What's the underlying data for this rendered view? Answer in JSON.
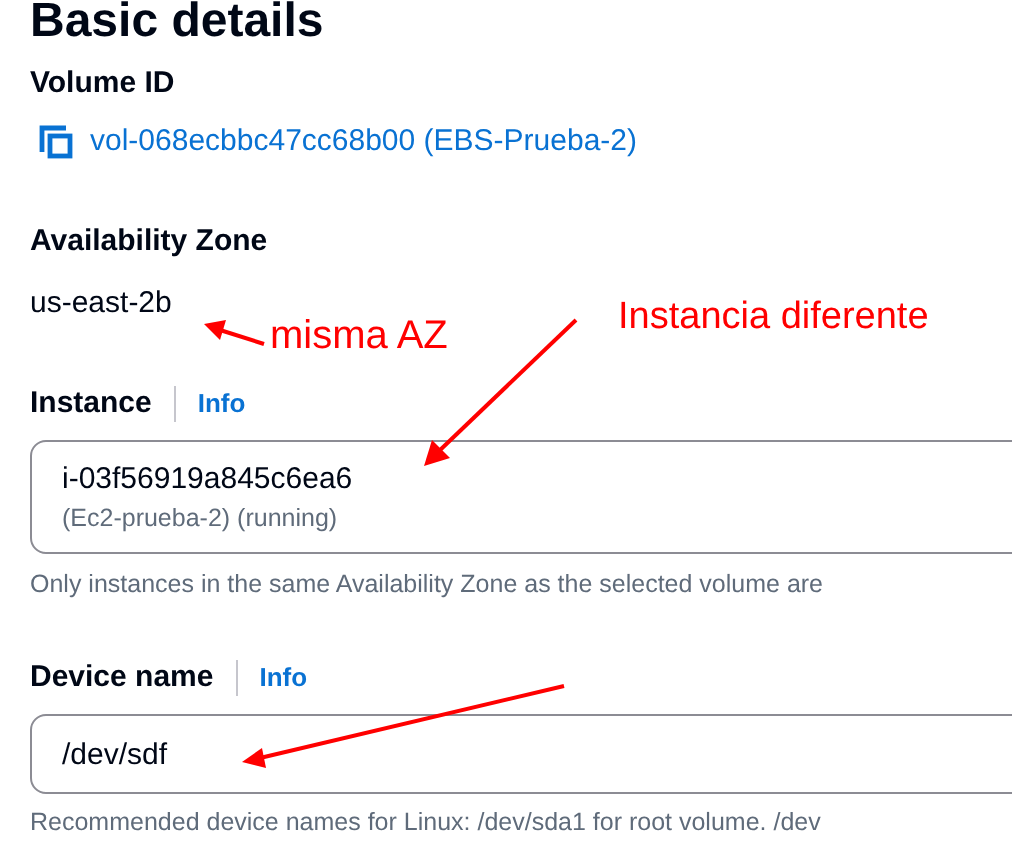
{
  "section": {
    "title": "Basic details"
  },
  "volume": {
    "label": "Volume ID",
    "link": "vol-068ecbbc47cc68b00 (EBS-Prueba-2)"
  },
  "availability_zone": {
    "label": "Availability Zone",
    "value": "us-east-2b"
  },
  "instance": {
    "label": "Instance",
    "info": "Info",
    "value": "i-03f56919a845c6ea6",
    "detail": "(Ec2-prueba-2) (running)",
    "help": "Only instances in the same Availability Zone as the selected volume are"
  },
  "device": {
    "label": "Device name",
    "info": "Info",
    "value": "/dev/sdf",
    "help": "Recommended device names for Linux: /dev/sda1 for root volume. /dev"
  },
  "annotations": [
    {
      "text": "misma AZ"
    },
    {
      "text": "Instancia diferente"
    }
  ]
}
